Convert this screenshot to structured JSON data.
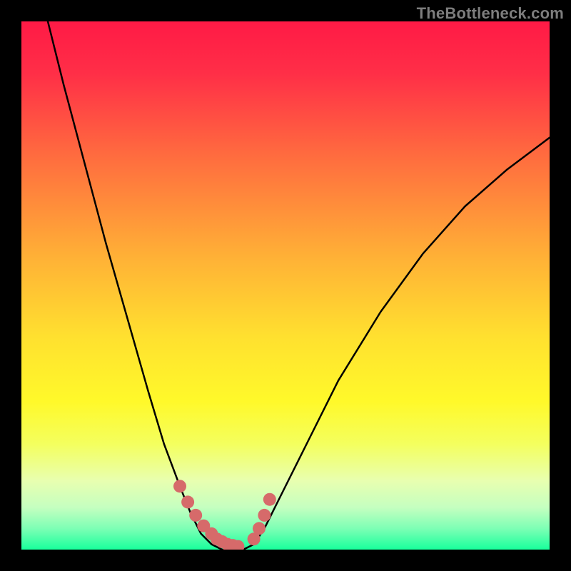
{
  "watermark": "TheBottleneck.com",
  "chart_data": {
    "type": "line",
    "title": "",
    "xlabel": "",
    "ylabel": "",
    "xlim": [
      0,
      100
    ],
    "ylim": [
      0,
      100
    ],
    "background_gradient_stops": [
      {
        "pos": 0.0,
        "color": "#ff1a46"
      },
      {
        "pos": 0.1,
        "color": "#ff2f47"
      },
      {
        "pos": 0.25,
        "color": "#ff6a3f"
      },
      {
        "pos": 0.45,
        "color": "#ffb236"
      },
      {
        "pos": 0.6,
        "color": "#ffe12f"
      },
      {
        "pos": 0.72,
        "color": "#fff92a"
      },
      {
        "pos": 0.8,
        "color": "#f4ff5e"
      },
      {
        "pos": 0.87,
        "color": "#e8ffb0"
      },
      {
        "pos": 0.92,
        "color": "#c5ffc0"
      },
      {
        "pos": 0.96,
        "color": "#7dffb5"
      },
      {
        "pos": 1.0,
        "color": "#18ff9c"
      }
    ],
    "series": [
      {
        "name": "bottleneck-curve-left",
        "color": "#000000",
        "x": [
          5,
          8,
          12,
          16,
          20,
          24,
          27,
          30,
          32,
          34,
          36
        ],
        "y": [
          100,
          88,
          73,
          58,
          44,
          30,
          20,
          12,
          7,
          3,
          1
        ]
      },
      {
        "name": "bottleneck-curve-right",
        "color": "#000000",
        "x": [
          44,
          46,
          49,
          54,
          60,
          68,
          76,
          84,
          92,
          100
        ],
        "y": [
          1,
          4,
          10,
          20,
          32,
          45,
          56,
          65,
          72,
          78
        ]
      },
      {
        "name": "valley-floor",
        "color": "#000000",
        "x": [
          36,
          38,
          40,
          42,
          44
        ],
        "y": [
          1,
          0,
          0,
          0,
          1
        ]
      }
    ],
    "markers": [
      {
        "name": "left-marker-cluster",
        "color": "#d66a6a",
        "x": [
          30,
          31.5,
          33,
          34.5,
          36,
          37,
          38,
          39,
          40,
          41
        ],
        "y": [
          12,
          9,
          6.5,
          4.5,
          3,
          2,
          1.5,
          1,
          0.8,
          0.6
        ]
      },
      {
        "name": "right-marker-cluster",
        "color": "#d66a6a",
        "x": [
          44,
          45,
          46,
          47
        ],
        "y": [
          2,
          4,
          6.5,
          9.5
        ]
      }
    ]
  }
}
